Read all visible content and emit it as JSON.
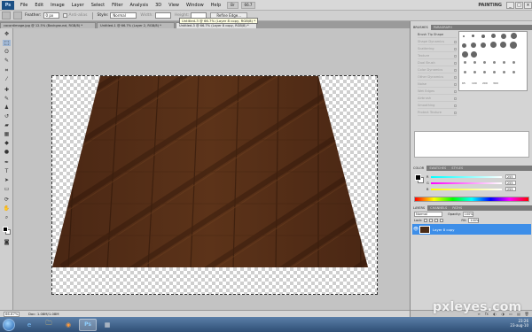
{
  "menu": {
    "app_badge": "Ps",
    "items": [
      "File",
      "Edit",
      "Image",
      "Layer",
      "Select",
      "Filter",
      "Analysis",
      "3D",
      "View",
      "Window",
      "Help"
    ],
    "zoom": "66.7",
    "workspace": "PAINTING",
    "window_buttons": [
      "_",
      "□",
      "×"
    ]
  },
  "options": {
    "feather_label": "Feather:",
    "feather_value": "0 px",
    "antialias": "Anti-alias",
    "style_label": "Style:",
    "style_value": "Normal",
    "width_label": "Width:",
    "height_label": "Height:",
    "refine_edge": "Refine Edge..."
  },
  "tooltip": "Untitled-3 @ 66.7% (Layer 8 copy, RGB/8) *",
  "tabs": [
    {
      "label": "cocordimage.jpg @ 12.5% (Background, RGB/8) *",
      "active": false
    },
    {
      "label": "Untitled-1 @ 66.7% (Layer 2, RGB/8) *",
      "active": false
    },
    {
      "label": "Untitled-3 @ 66.7% (Layer 8 copy, RGB/8) *",
      "active": true
    }
  ],
  "status": {
    "zoom": "66.67%",
    "doc": "Doc: 1.08M/1.08M"
  },
  "panels": {
    "brushes_tabs": [
      "BRUSHES",
      "PARAGRAPH"
    ],
    "brush_options": [
      "Brush Tip Shape",
      "Shape Dynamics",
      "Scattering",
      "Texture",
      "Dual Brush",
      "Color Dynamics",
      "Other Dynamics",
      "Noise",
      "Wet Edges",
      "Airbrush",
      "Smoothing",
      "Protect Texture"
    ],
    "brush_numbers": [
      "1",
      "3",
      "5",
      "9",
      "13",
      "19",
      "5",
      "9",
      "13",
      "17",
      "21",
      "27",
      "35",
      "45",
      "65",
      "100",
      "200",
      "300"
    ],
    "color_tabs": [
      "COLOR",
      "SWATCHES",
      "STYLES"
    ],
    "rgb": [
      {
        "label": "R",
        "value": "255",
        "color": "#ff0000"
      },
      {
        "label": "G",
        "value": "255",
        "color": "#00ff00"
      },
      {
        "label": "B",
        "value": "255",
        "color": "#0000ff"
      }
    ],
    "layers_tabs": [
      "LAYERS",
      "CHANNELS",
      "PATHS"
    ],
    "blend_mode": "Normal",
    "opacity_label": "Opacity:",
    "opacity": "100%",
    "lock_label": "Lock:",
    "fill_label": "Fill:",
    "fill": "100%",
    "layer_name": "Layer 8 copy",
    "layer_footer_icons": [
      "∞",
      "fx",
      "◐",
      "◑",
      "▭",
      "▤",
      "🗑"
    ]
  },
  "colors": {
    "wood_dark": "#3a1e0d",
    "wood_mid": "#5a3318",
    "wood_light": "#6b3d1d",
    "selection_blue": "#3d8ee8"
  },
  "taskbar": {
    "icons": [
      "e",
      "🗀",
      "◉",
      "Ps",
      "▦"
    ],
    "time": "23:26",
    "date": "23-aug-10"
  },
  "watermark": "pxleyes.com"
}
